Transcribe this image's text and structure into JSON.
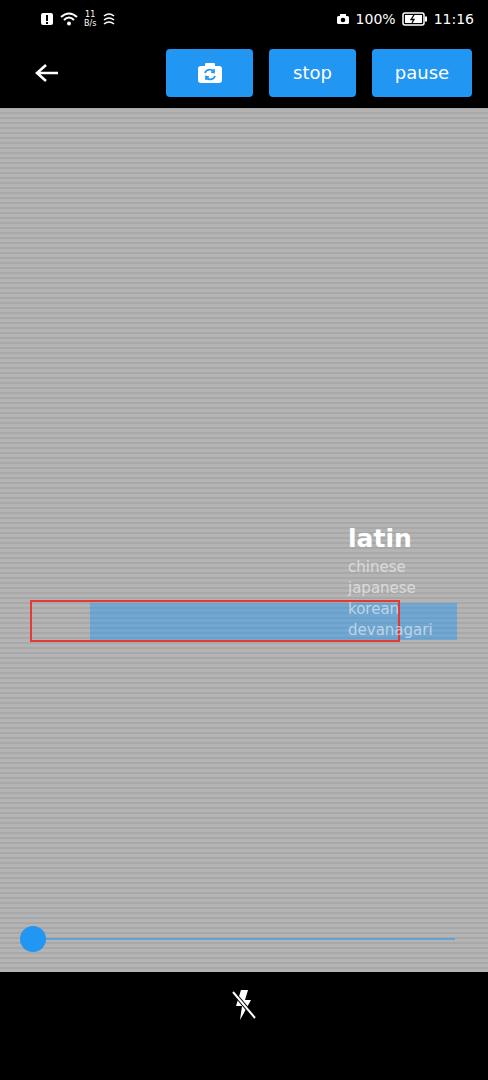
{
  "status_bar": {
    "speed_value": "11",
    "speed_unit": "B/s",
    "battery": "100%",
    "time": "11:16"
  },
  "toolbar": {
    "buttons": [
      {
        "label": "stop"
      },
      {
        "label": "pause"
      }
    ]
  },
  "scripts": [
    {
      "label": "latin",
      "selected": true
    },
    {
      "label": "chinese",
      "selected": false
    },
    {
      "label": "japanese",
      "selected": false
    },
    {
      "label": "korean",
      "selected": false
    },
    {
      "label": "devanagari",
      "selected": false
    }
  ],
  "zoom": {
    "level": 0
  }
}
